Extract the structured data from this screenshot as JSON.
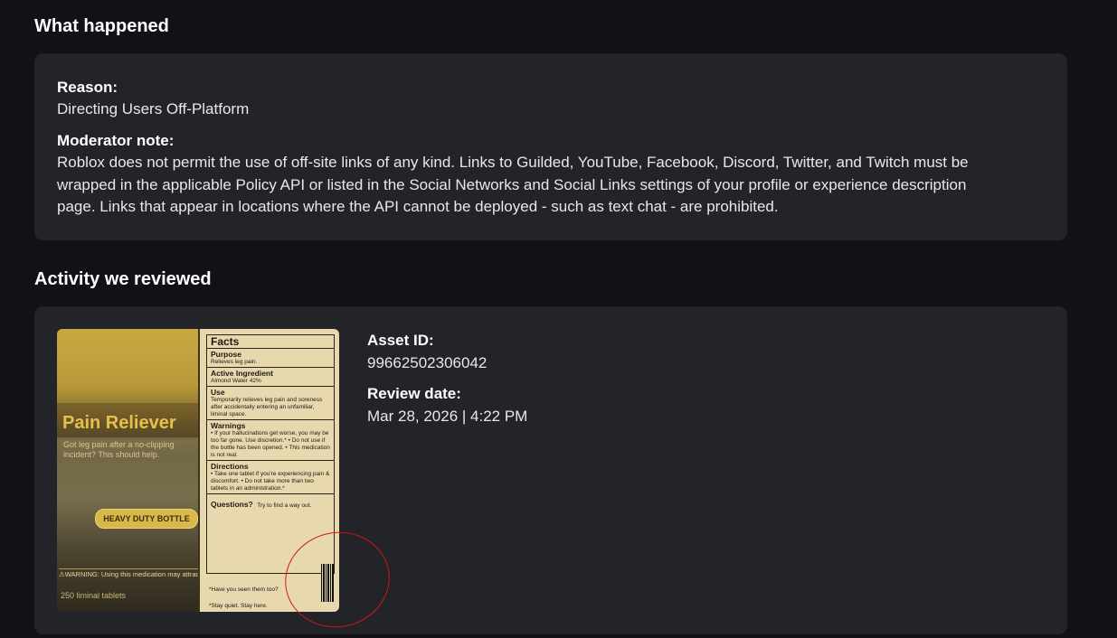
{
  "what_happened": {
    "title": "What happened",
    "reason_label": "Reason:",
    "reason_value": "Directing Users Off-Platform",
    "note_label": "Moderator note:",
    "note_lines": [
      "Roblox does not permit the use of off-site links of any kind. Links to Guilded, YouTube, Facebook, Discord, Twitter, and Twitch must be",
      "wrapped in the applicable Policy API or listed in the Social Networks and Social Links settings of your profile or experience description",
      "page. Links that appear in locations where the API cannot be deployed - such as text chat - are prohibited."
    ]
  },
  "activity": {
    "title": "Activity we reviewed",
    "asset_id_label": "Asset ID:",
    "asset_id_value": "99662502306042",
    "review_date_label": "Review date:",
    "review_date_value": "Mar 28, 2026 | 4:22 PM"
  },
  "product_image": {
    "name": "Pain Reliever",
    "tagline": "Got leg pain after a no-clipping incident? This should help.",
    "pill": "HEAVY DUTY BOTTLE",
    "warning": "⚠WARNING: Using this medication may attract entities",
    "count": "250 liminal tablets",
    "facts_title": "Facts",
    "facts": [
      {
        "title": "Purpose",
        "body": "Relieves leg pain."
      },
      {
        "title": "Active Ingredient",
        "body": "Almond Water 42%"
      },
      {
        "title": "Use",
        "body": "Temporarily relieves leg pain and soreness after accidentally entering an unfamiliar, liminal space."
      },
      {
        "title": "Warnings",
        "body": "• If your hallucinations get worse, you may be too far gone. Use discretion.* • Do not use if the bottle has been opened. • This medication is not real."
      },
      {
        "title": "Directions",
        "body": "• Take one tablet if you're experiencing pain & discomfort. • Do not take more than two tablets in an administration.*"
      },
      {
        "title": "Questions?",
        "body": "Try to find a way out."
      }
    ],
    "footnote_1": "*Have you seen them too?",
    "footnote_2": "*Stay quiet. Stay here.",
    "circle_color": "#d01818"
  }
}
